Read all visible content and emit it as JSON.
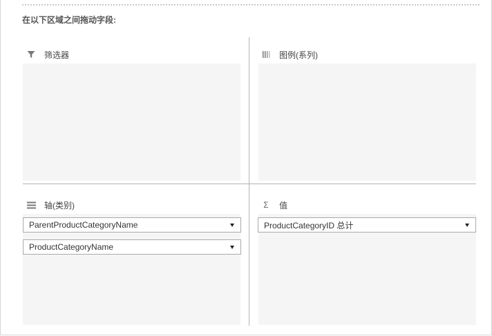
{
  "heading": "在以下区域之间拖动字段:",
  "zones": {
    "filters": {
      "label": "筛选器",
      "icon": "filter-icon"
    },
    "legend": {
      "label": "图例(系列)",
      "icon": "legend-series-icon"
    },
    "axis": {
      "label": "轴(类别)",
      "icon": "axis-category-icon",
      "fields": [
        "ParentProductCategoryName",
        "ProductCategoryName"
      ]
    },
    "values": {
      "label": "值",
      "icon": "sigma-icon",
      "sigma": "Σ",
      "fields": [
        "ProductCategoryID 总计"
      ]
    }
  },
  "colors": {
    "zone_background": "#f5f5f5",
    "divider": "#b3b3b3",
    "field_border": "#a9a9a9"
  }
}
